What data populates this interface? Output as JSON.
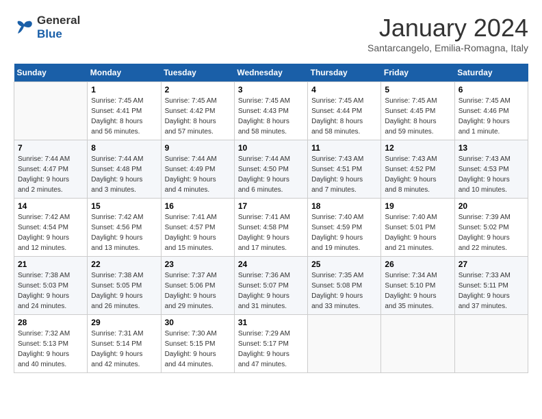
{
  "logo": {
    "line1": "General",
    "line2": "Blue"
  },
  "title": "January 2024",
  "subtitle": "Santarcangelo, Emilia-Romagna, Italy",
  "weekdays": [
    "Sunday",
    "Monday",
    "Tuesday",
    "Wednesday",
    "Thursday",
    "Friday",
    "Saturday"
  ],
  "weeks": [
    [
      {
        "day": "",
        "info": ""
      },
      {
        "day": "1",
        "info": "Sunrise: 7:45 AM\nSunset: 4:41 PM\nDaylight: 8 hours\nand 56 minutes."
      },
      {
        "day": "2",
        "info": "Sunrise: 7:45 AM\nSunset: 4:42 PM\nDaylight: 8 hours\nand 57 minutes."
      },
      {
        "day": "3",
        "info": "Sunrise: 7:45 AM\nSunset: 4:43 PM\nDaylight: 8 hours\nand 58 minutes."
      },
      {
        "day": "4",
        "info": "Sunrise: 7:45 AM\nSunset: 4:44 PM\nDaylight: 8 hours\nand 58 minutes."
      },
      {
        "day": "5",
        "info": "Sunrise: 7:45 AM\nSunset: 4:45 PM\nDaylight: 8 hours\nand 59 minutes."
      },
      {
        "day": "6",
        "info": "Sunrise: 7:45 AM\nSunset: 4:46 PM\nDaylight: 9 hours\nand 1 minute."
      }
    ],
    [
      {
        "day": "7",
        "info": "Sunrise: 7:44 AM\nSunset: 4:47 PM\nDaylight: 9 hours\nand 2 minutes."
      },
      {
        "day": "8",
        "info": "Sunrise: 7:44 AM\nSunset: 4:48 PM\nDaylight: 9 hours\nand 3 minutes."
      },
      {
        "day": "9",
        "info": "Sunrise: 7:44 AM\nSunset: 4:49 PM\nDaylight: 9 hours\nand 4 minutes."
      },
      {
        "day": "10",
        "info": "Sunrise: 7:44 AM\nSunset: 4:50 PM\nDaylight: 9 hours\nand 6 minutes."
      },
      {
        "day": "11",
        "info": "Sunrise: 7:43 AM\nSunset: 4:51 PM\nDaylight: 9 hours\nand 7 minutes."
      },
      {
        "day": "12",
        "info": "Sunrise: 7:43 AM\nSunset: 4:52 PM\nDaylight: 9 hours\nand 8 minutes."
      },
      {
        "day": "13",
        "info": "Sunrise: 7:43 AM\nSunset: 4:53 PM\nDaylight: 9 hours\nand 10 minutes."
      }
    ],
    [
      {
        "day": "14",
        "info": "Sunrise: 7:42 AM\nSunset: 4:54 PM\nDaylight: 9 hours\nand 12 minutes."
      },
      {
        "day": "15",
        "info": "Sunrise: 7:42 AM\nSunset: 4:56 PM\nDaylight: 9 hours\nand 13 minutes."
      },
      {
        "day": "16",
        "info": "Sunrise: 7:41 AM\nSunset: 4:57 PM\nDaylight: 9 hours\nand 15 minutes."
      },
      {
        "day": "17",
        "info": "Sunrise: 7:41 AM\nSunset: 4:58 PM\nDaylight: 9 hours\nand 17 minutes."
      },
      {
        "day": "18",
        "info": "Sunrise: 7:40 AM\nSunset: 4:59 PM\nDaylight: 9 hours\nand 19 minutes."
      },
      {
        "day": "19",
        "info": "Sunrise: 7:40 AM\nSunset: 5:01 PM\nDaylight: 9 hours\nand 21 minutes."
      },
      {
        "day": "20",
        "info": "Sunrise: 7:39 AM\nSunset: 5:02 PM\nDaylight: 9 hours\nand 22 minutes."
      }
    ],
    [
      {
        "day": "21",
        "info": "Sunrise: 7:38 AM\nSunset: 5:03 PM\nDaylight: 9 hours\nand 24 minutes."
      },
      {
        "day": "22",
        "info": "Sunrise: 7:38 AM\nSunset: 5:05 PM\nDaylight: 9 hours\nand 26 minutes."
      },
      {
        "day": "23",
        "info": "Sunrise: 7:37 AM\nSunset: 5:06 PM\nDaylight: 9 hours\nand 29 minutes."
      },
      {
        "day": "24",
        "info": "Sunrise: 7:36 AM\nSunset: 5:07 PM\nDaylight: 9 hours\nand 31 minutes."
      },
      {
        "day": "25",
        "info": "Sunrise: 7:35 AM\nSunset: 5:08 PM\nDaylight: 9 hours\nand 33 minutes."
      },
      {
        "day": "26",
        "info": "Sunrise: 7:34 AM\nSunset: 5:10 PM\nDaylight: 9 hours\nand 35 minutes."
      },
      {
        "day": "27",
        "info": "Sunrise: 7:33 AM\nSunset: 5:11 PM\nDaylight: 9 hours\nand 37 minutes."
      }
    ],
    [
      {
        "day": "28",
        "info": "Sunrise: 7:32 AM\nSunset: 5:13 PM\nDaylight: 9 hours\nand 40 minutes."
      },
      {
        "day": "29",
        "info": "Sunrise: 7:31 AM\nSunset: 5:14 PM\nDaylight: 9 hours\nand 42 minutes."
      },
      {
        "day": "30",
        "info": "Sunrise: 7:30 AM\nSunset: 5:15 PM\nDaylight: 9 hours\nand 44 minutes."
      },
      {
        "day": "31",
        "info": "Sunrise: 7:29 AM\nSunset: 5:17 PM\nDaylight: 9 hours\nand 47 minutes."
      },
      {
        "day": "",
        "info": ""
      },
      {
        "day": "",
        "info": ""
      },
      {
        "day": "",
        "info": ""
      }
    ]
  ]
}
